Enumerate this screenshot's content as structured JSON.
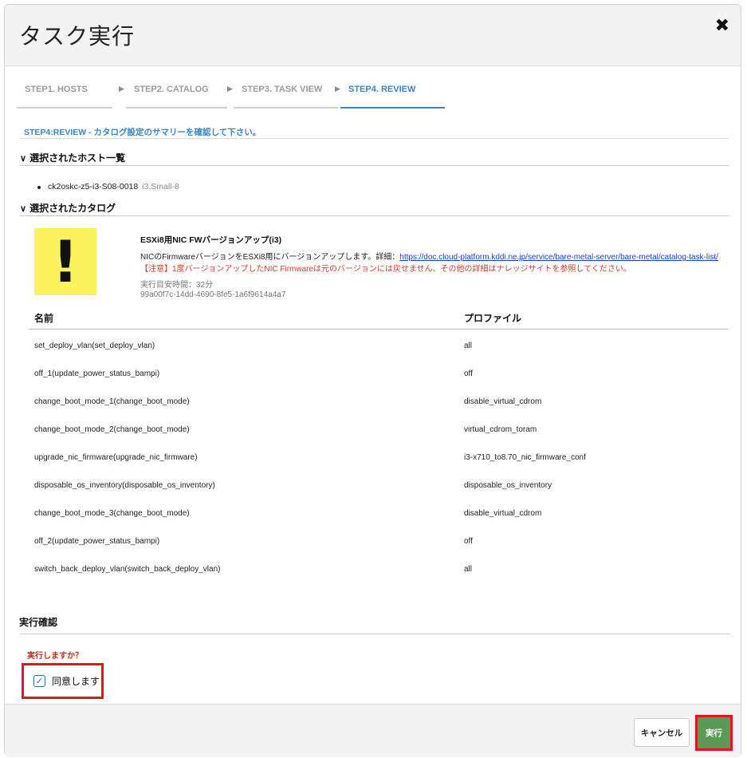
{
  "dialog": {
    "title": "タスク実行",
    "close_icon": "close-icon"
  },
  "steps": [
    {
      "label": "STEP1. HOSTS"
    },
    {
      "label": "STEP2. CATALOG"
    },
    {
      "label": "STEP3. TASK VIEW"
    },
    {
      "label": "STEP4. REVIEW"
    }
  ],
  "review_note": "STEP4:REVIEW - カタログ設定のサマリーを確認して下さい。",
  "hosts_section": {
    "heading": "選択されたホスト一覧",
    "items": [
      {
        "name": "ck2oskc-z5-i3-S08-0018",
        "flavor": "i3.Small-8"
      }
    ]
  },
  "catalog_section": {
    "heading": "選択されたカタログ",
    "title": "ESXi8用NIC FWバージョンアップ(i3)",
    "description": "NICのFirmwareバージョンをESXi8用にバージョンアップします。詳細：",
    "link": "https://doc.cloud-platform.kddi.ne.jp/service/bare-metal-server/bare-metal/catalog-task-list/",
    "warning": "【注意】1度バージョンアップしたNIC Firmwareは元のバージョンには戻せません、その他の詳細はナレッジサイトを参照してください。",
    "time": "実行目安時間：32分",
    "id": "99a00f7c-14dd-4690-8fe5-1a6f9614a4a7"
  },
  "table": {
    "headers": {
      "name": "名前",
      "profile": "プロファイル"
    },
    "rows": [
      {
        "name": "set_deploy_vlan(set_deploy_vlan)",
        "profile": "all"
      },
      {
        "name": "off_1(update_power_status_bampi)",
        "profile": "off"
      },
      {
        "name": "change_boot_mode_1(change_boot_mode)",
        "profile": "disable_virtual_cdrom"
      },
      {
        "name": "change_boot_mode_2(change_boot_mode)",
        "profile": "virtual_cdrom_toram"
      },
      {
        "name": "upgrade_nic_firmware(upgrade_nic_firmware)",
        "profile": "i3-x710_to8.70_nic_firmware_conf"
      },
      {
        "name": "disposable_os_inventory(disposable_os_inventory)",
        "profile": "disposable_os_inventory"
      },
      {
        "name": "change_boot_mode_3(change_boot_mode)",
        "profile": "disable_virtual_cdrom"
      },
      {
        "name": "off_2(update_power_status_bampi)",
        "profile": "off"
      },
      {
        "name": "switch_back_deploy_vlan(switch_back_deploy_vlan)",
        "profile": "all"
      }
    ]
  },
  "confirm": {
    "heading": "実行確認",
    "question": "実行しますか？",
    "agree_label": "同意します",
    "agree_checked": true
  },
  "footer": {
    "cancel_label": "キャンセル",
    "execute_label": "実行"
  },
  "colors": {
    "accent": "#3a86c4",
    "warning": "#d23c2c",
    "execute": "#5b9a55",
    "highlight": "#e3141d"
  }
}
